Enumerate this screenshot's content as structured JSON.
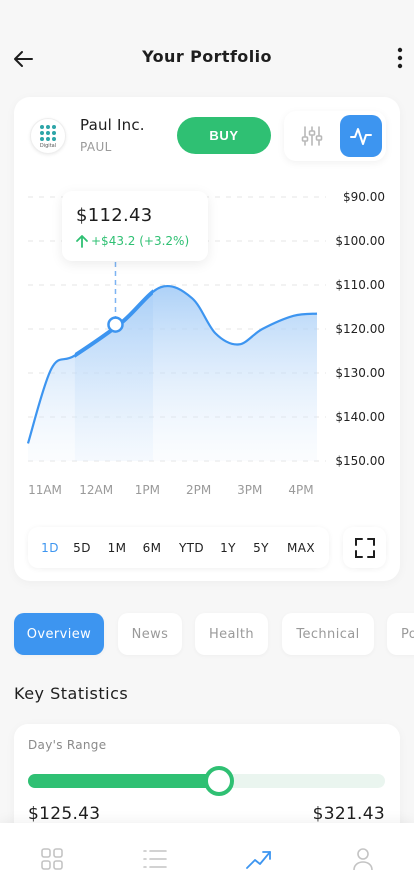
{
  "header": {
    "title": "Your Portfolio"
  },
  "stock": {
    "name": "Paul Inc.",
    "ticker": "PAUL",
    "logo_text": "Digital",
    "buy_label": "BUY"
  },
  "tooltip": {
    "price": "$112.43",
    "change": "+$43.2 (+3.2%)"
  },
  "ranges": [
    {
      "label": "1D",
      "active": true
    },
    {
      "label": "5D"
    },
    {
      "label": "1M"
    },
    {
      "label": "6M"
    },
    {
      "label": "YTD"
    },
    {
      "label": "1Y"
    },
    {
      "label": "5Y"
    },
    {
      "label": "MAX"
    }
  ],
  "tabs": [
    {
      "label": "Overview",
      "active": true
    },
    {
      "label": "News"
    },
    {
      "label": "Health"
    },
    {
      "label": "Technical"
    },
    {
      "label": "Po"
    }
  ],
  "key_statistics": {
    "title": "Key Statistics",
    "days_range": {
      "label": "Day's Range",
      "low": "$125.43",
      "high": "$321.43",
      "position": 0.535
    }
  },
  "icons": {
    "back": "arrow-left-icon",
    "more": "more-vertical-icon",
    "settings": "sliders-icon",
    "activity": "activity-icon",
    "fullscreen": "fullscreen-icon",
    "nav": [
      "grid-icon",
      "list-icon",
      "trending-icon",
      "user-icon"
    ]
  },
  "colors": {
    "accent": "#3d95f0",
    "buy": "#2fc073",
    "positive": "#2fc073"
  },
  "chart_data": {
    "type": "area",
    "y_axis_labels": [
      "$90.00",
      "$100.00",
      "$110.00",
      "$120.00",
      "$130.00",
      "$140.00",
      "$150.00"
    ],
    "y_ticks": [
      90,
      100,
      110,
      120,
      130,
      140,
      150
    ],
    "ylim": [
      90,
      150
    ],
    "y_inverted": true,
    "x_axis_labels": [
      "11AM",
      "12AM",
      "1PM",
      "2PM",
      "3PM",
      "4PM"
    ],
    "series": [
      {
        "values": [
          {
            "x": 0.0,
            "y": 146
          },
          {
            "x": 0.3,
            "y": 129
          },
          {
            "x": 0.6,
            "y": 126
          },
          {
            "x": 1.2,
            "y": 118.5
          },
          {
            "x": 1.7,
            "y": 110.5
          },
          {
            "x": 2.1,
            "y": 113
          },
          {
            "x": 2.4,
            "y": 121
          },
          {
            "x": 2.7,
            "y": 123.5
          },
          {
            "x": 3.0,
            "y": 120
          },
          {
            "x": 3.4,
            "y": 117
          },
          {
            "x": 3.7,
            "y": 116.5
          }
        ]
      }
    ],
    "highlight": {
      "start_x": 0.6,
      "end_x": 1.6,
      "marker_x": 1.12,
      "marker_y": 119
    },
    "grid": true,
    "grid_style": "dashed"
  }
}
